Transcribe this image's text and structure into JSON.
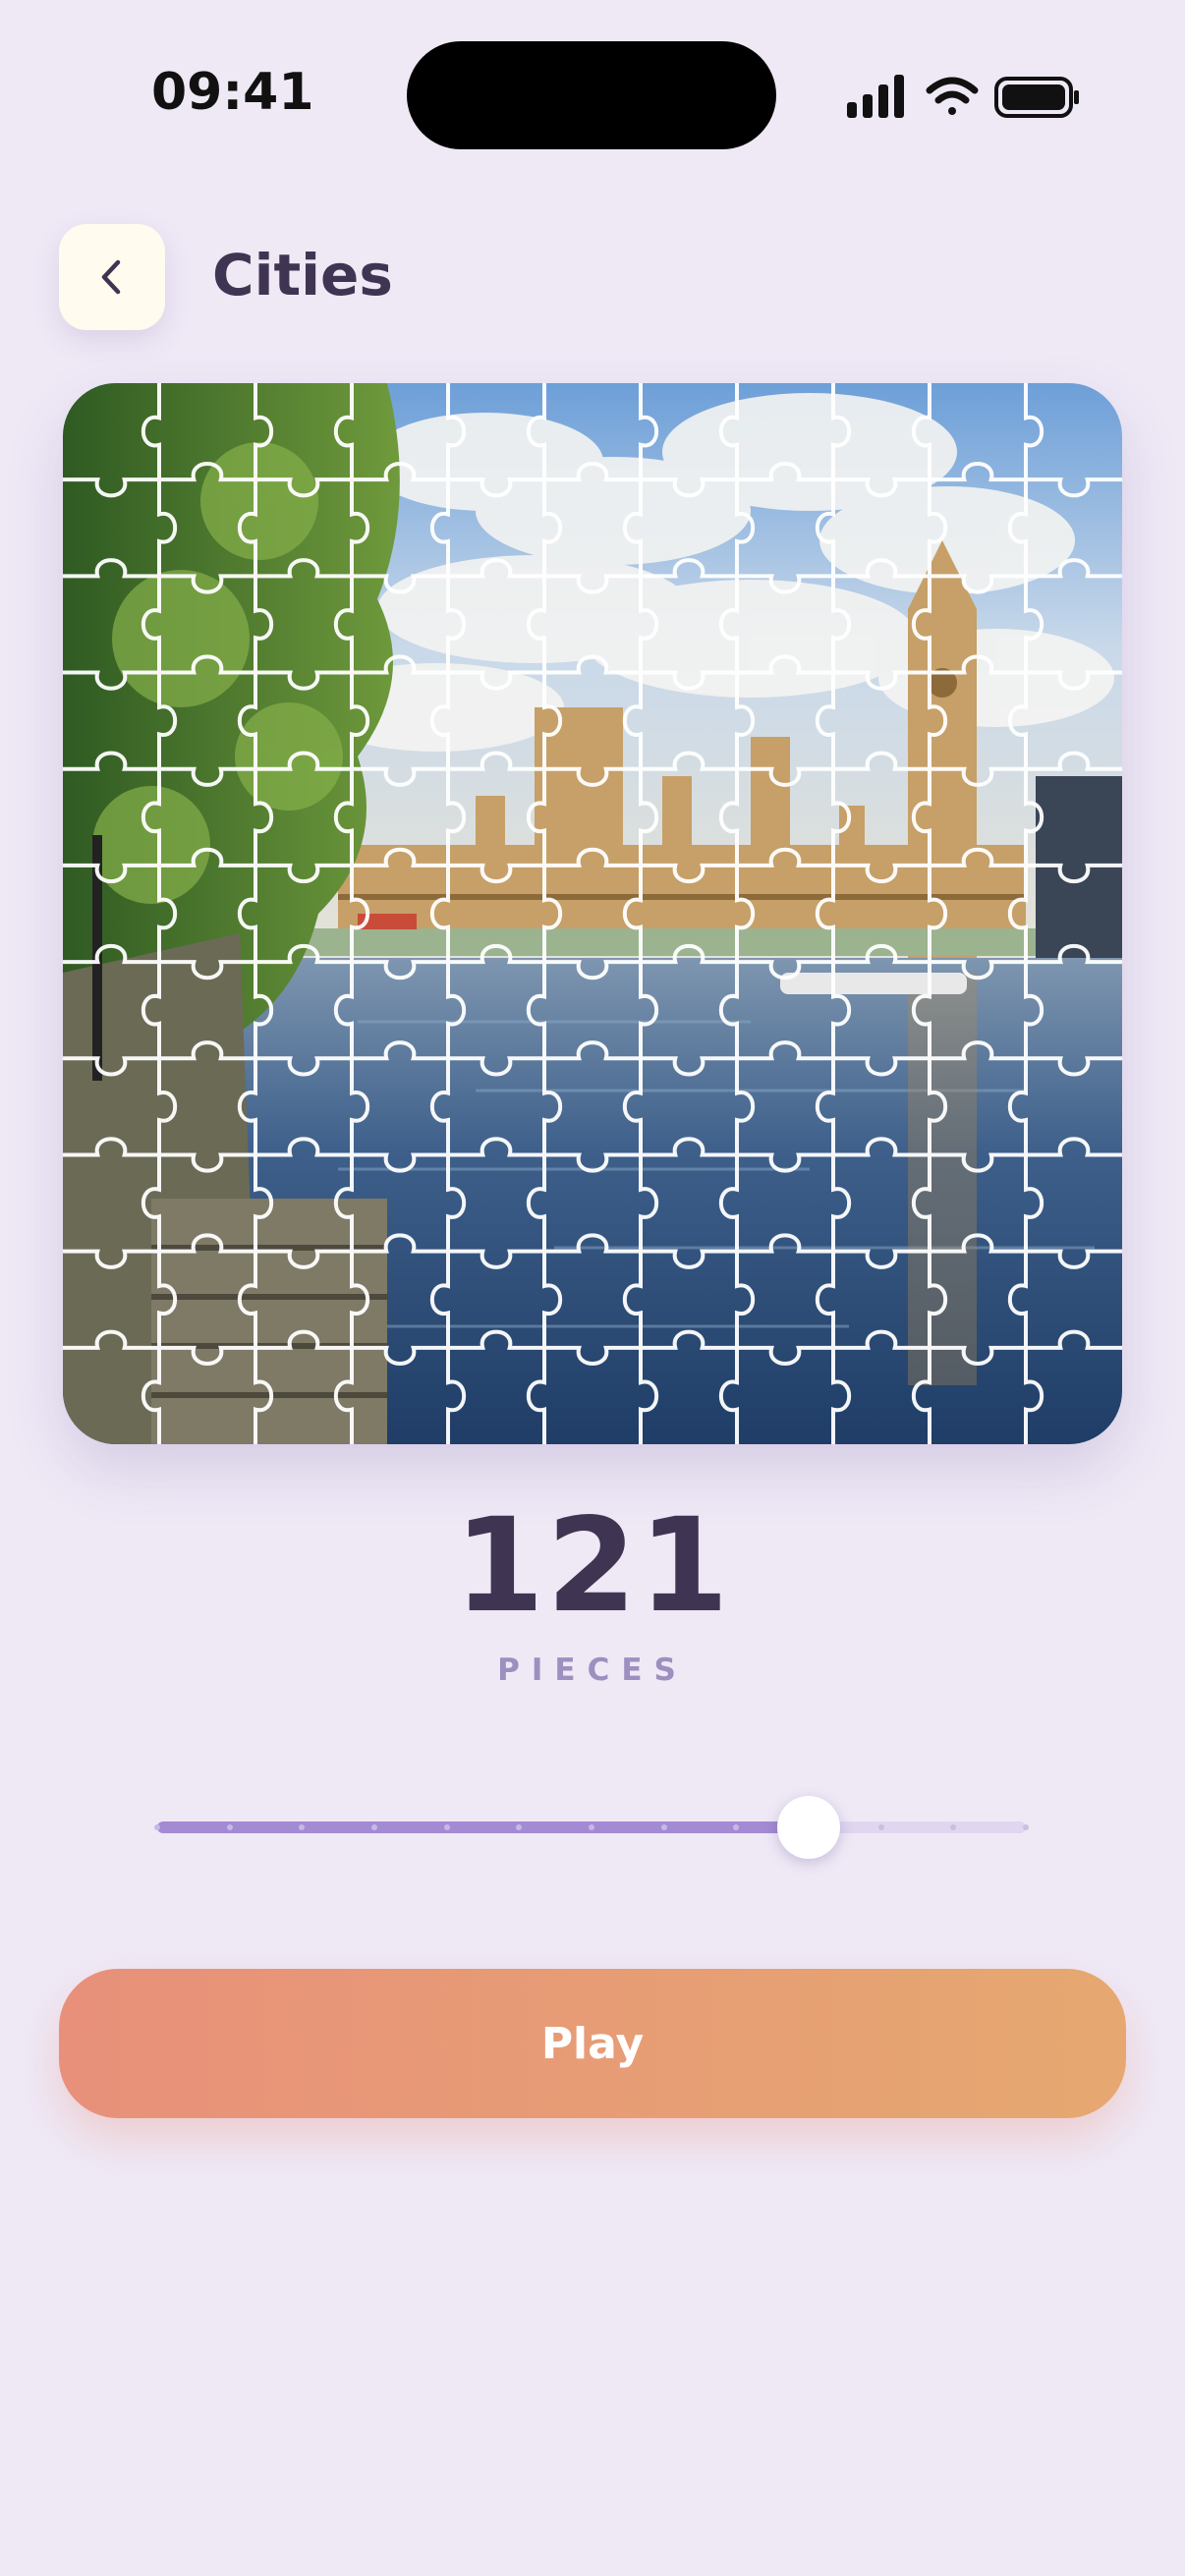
{
  "status_bar": {
    "time": "09:41"
  },
  "header": {
    "back_icon": "chevron-left-icon",
    "title": "Cities"
  },
  "puzzle": {
    "image_subject": "puzzle-preview-image",
    "columns": 11,
    "rows": 11
  },
  "piece_count": {
    "value": "121",
    "label": "PIECES"
  },
  "slider": {
    "steps": 13,
    "selected_step": 9,
    "fraction": 0.75
  },
  "play_button": {
    "label": "Play"
  },
  "colors": {
    "background": "#efe9f6",
    "accent": "#a38bd3",
    "title_text": "#3f3553",
    "play_gradient_start": "#e8907a",
    "play_gradient_end": "#e6a870"
  }
}
